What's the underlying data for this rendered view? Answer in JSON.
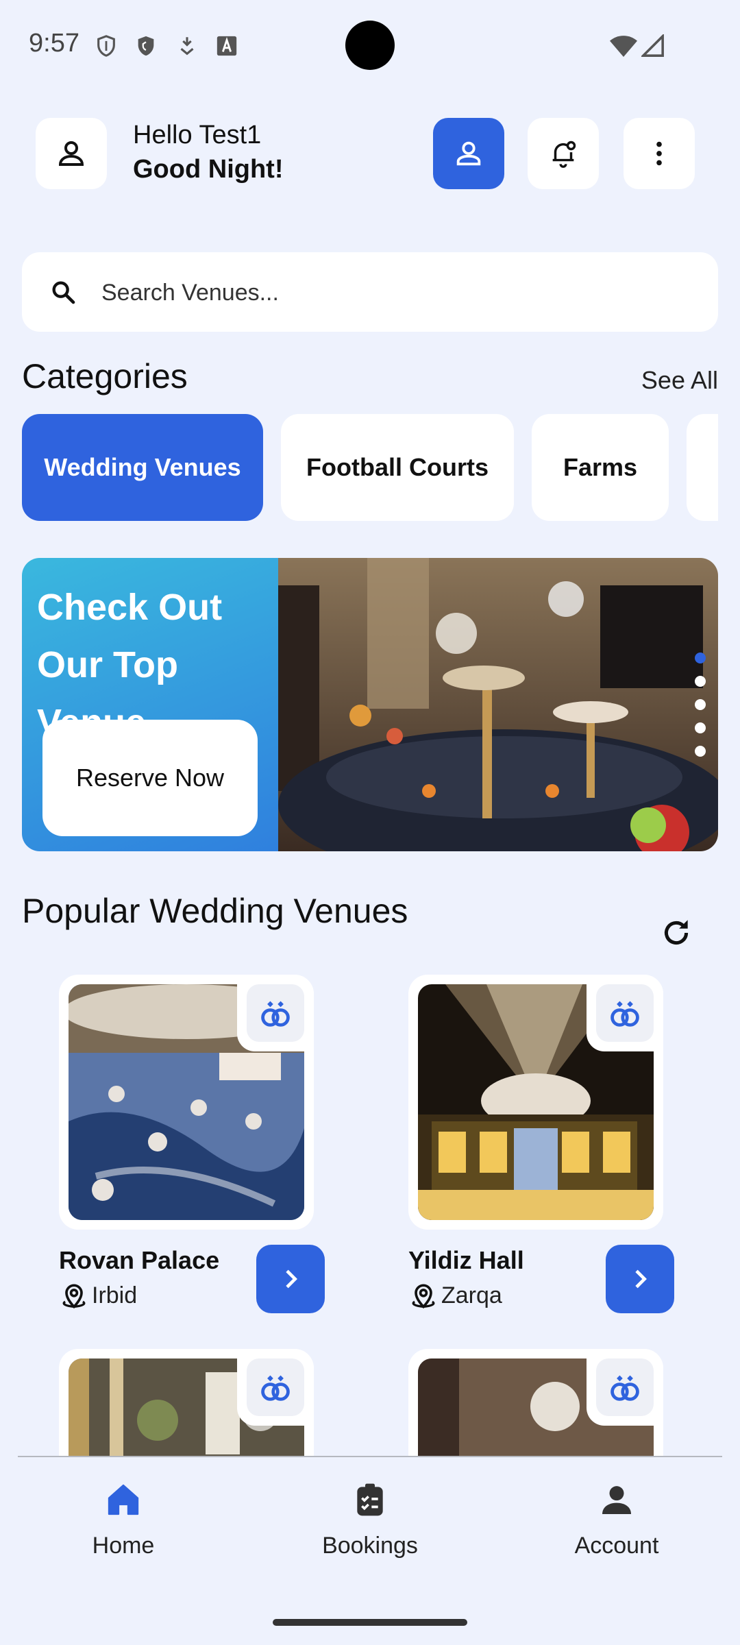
{
  "status_bar": {
    "time": "9:57",
    "icons": [
      "shield-outline-icon",
      "shield-filled-icon",
      "download-arrow-icon",
      "font-a-icon",
      "wifi-icon",
      "cell-signal-icon"
    ]
  },
  "header": {
    "greeting": "Hello Test1",
    "subtitle": "Good Night!"
  },
  "search": {
    "placeholder": "Search Venues..."
  },
  "categories": {
    "title": "Categories",
    "see_all": "See All",
    "items": [
      {
        "label": "Wedding Venues",
        "active": true
      },
      {
        "label": "Football Courts",
        "active": false
      },
      {
        "label": "Farms",
        "active": false
      }
    ]
  },
  "banner": {
    "title": "Check Out Our Top Venue",
    "button": "Reserve Now",
    "page_count": 5,
    "active_page": 0
  },
  "popular": {
    "title": "Popular Wedding Venues",
    "venues": [
      {
        "name": "Rovan Palace",
        "location": "Irbid"
      },
      {
        "name": "Yildiz Hall",
        "location": "Zarqa"
      },
      {
        "name": "",
        "location": ""
      },
      {
        "name": "",
        "location": ""
      }
    ]
  },
  "bottom_nav": {
    "items": [
      {
        "label": "Home",
        "icon": "home-icon",
        "active": true
      },
      {
        "label": "Bookings",
        "icon": "clipboard-list-icon",
        "active": false
      },
      {
        "label": "Account",
        "icon": "person-icon",
        "active": false
      }
    ]
  },
  "colors": {
    "accent": "#2f63de",
    "background": "#eef2fd",
    "card": "#ffffff"
  }
}
